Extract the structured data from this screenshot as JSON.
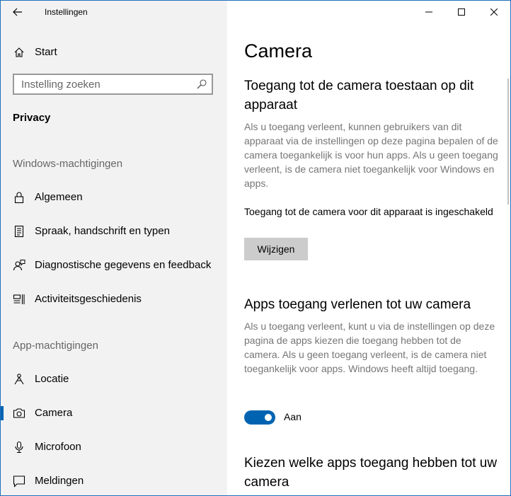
{
  "window": {
    "title": "Instellingen"
  },
  "sidebar": {
    "home_label": "Start",
    "search_placeholder": "Instelling zoeken",
    "section_title": "Privacy",
    "group_windows": "Windows-machtigingen",
    "windows_items": [
      {
        "label": "Algemeen",
        "icon": "lock-icon"
      },
      {
        "label": "Spraak, handschrift en typen",
        "icon": "speech-document-icon"
      },
      {
        "label": "Diagnostische gegevens en feedback",
        "icon": "feedback-person-icon"
      },
      {
        "label": "Activiteitsgeschiedenis",
        "icon": "activity-history-icon"
      }
    ],
    "group_apps": "App-machtigingen",
    "app_items": [
      {
        "label": "Locatie",
        "icon": "location-icon"
      },
      {
        "label": "Camera",
        "icon": "camera-icon",
        "active": true
      },
      {
        "label": "Microfoon",
        "icon": "microphone-icon"
      },
      {
        "label": "Meldingen",
        "icon": "notification-icon"
      }
    ]
  },
  "main": {
    "page_title": "Camera",
    "device_access": {
      "heading": "Toegang tot de camera toestaan op dit apparaat",
      "description": "Als u toegang verleent, kunnen gebruikers van dit apparaat via de instellingen op deze pagina bepalen of de camera toegankelijk is voor hun apps. Als u geen toegang verleent, is de camera niet toegankelijk voor Windows en apps.",
      "status": "Toegang tot de camera voor dit apparaat is ingeschakeld",
      "change_button": "Wijzigen"
    },
    "app_access": {
      "heading": "Apps toegang verlenen tot uw camera",
      "description": "Als u toegang verleent, kunt u via de instellingen op deze pagina de apps kiezen die toegang hebben tot de camera. Als u geen toegang verleent, is de camera niet toegankelijk voor apps. Windows heeft altijd toegang.",
      "toggle_on": true,
      "toggle_label": "Aan"
    },
    "choose_apps": {
      "heading": "Kiezen welke apps toegang hebben tot uw camera"
    }
  },
  "colors": {
    "accent": "#0063b1",
    "sidebar_bg": "#f2f2f2",
    "muted_text": "#767676",
    "button_bg": "#cccccc"
  }
}
